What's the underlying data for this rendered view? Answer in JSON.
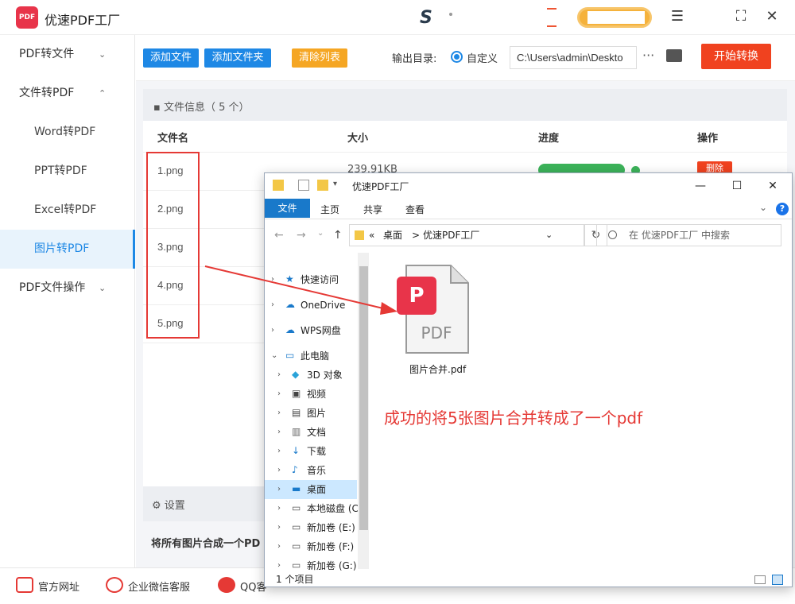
{
  "app": {
    "title": "优速PDF工厂",
    "logo_text": "PDF",
    "window_controls": [
      "menu-icon",
      "fullscreen-icon",
      "close-icon"
    ]
  },
  "sidebar": {
    "items": [
      {
        "label": "PDF转文件",
        "expanded": false
      },
      {
        "label": "文件转PDF",
        "expanded": true
      },
      {
        "label": "Word转PDF"
      },
      {
        "label": "PPT转PDF"
      },
      {
        "label": "Excel转PDF"
      },
      {
        "label": "图片转PDF",
        "active": true
      },
      {
        "label": "PDF文件操作",
        "expanded": false
      }
    ]
  },
  "toolbar": {
    "add_file": "添加文件",
    "add_folder": "添加文件夹",
    "clear_list": "清除列表",
    "output_label": "输出目录:",
    "custom_label": "自定义",
    "output_path": "C:\\Users\\admin\\Deskto",
    "more": "···",
    "start": "开始转换"
  },
  "file_list": {
    "info": "文件信息（ 5 个）",
    "headers": {
      "name": "文件名",
      "size": "大小",
      "progress": "进度",
      "action": "操作"
    },
    "files": [
      "1.png",
      "2.png",
      "3.png",
      "4.png",
      "5.png"
    ],
    "first_size": "239.91KB",
    "first_progress": 1.0,
    "delete_label": "删除"
  },
  "settings": {
    "label": "设置",
    "merge_option": "将所有图片合成一个PD"
  },
  "bottom": {
    "website": "官方网址",
    "wechat": "企业微信客服",
    "qq": "QQ客"
  },
  "explorer": {
    "title": "优速PDF工厂",
    "ribbon": {
      "file": "文件",
      "home": "主页",
      "share": "共享",
      "view": "查看"
    },
    "address": {
      "prefix": "«",
      "desktop": "桌面",
      "sep": ">",
      "folder": "优速PDF工厂"
    },
    "search_placeholder": "在 优速PDF工厂 中搜索",
    "nav": [
      {
        "label": "快速访问",
        "icon": "star-icon"
      },
      {
        "label": "OneDrive",
        "icon": "cloud-icon"
      },
      {
        "label": "WPS网盘",
        "icon": "cloud-icon"
      },
      {
        "label": "此电脑",
        "icon": "computer-icon"
      },
      {
        "label": "3D 对象",
        "icon": "cube-icon"
      },
      {
        "label": "视频",
        "icon": "video-icon"
      },
      {
        "label": "图片",
        "icon": "picture-icon"
      },
      {
        "label": "文档",
        "icon": "document-icon"
      },
      {
        "label": "下载",
        "icon": "download-icon"
      },
      {
        "label": "音乐",
        "icon": "music-icon"
      },
      {
        "label": "桌面",
        "icon": "desktop-icon",
        "selected": true
      },
      {
        "label": "本地磁盘 (C",
        "icon": "drive-icon"
      },
      {
        "label": "新加卷 (E:)",
        "icon": "drive-icon"
      },
      {
        "label": "新加卷 (F:)",
        "icon": "drive-icon"
      },
      {
        "label": "新加卷 (G:)",
        "icon": "drive-icon"
      }
    ],
    "file": {
      "name": "图片合并.pdf",
      "icon_text": "PDF"
    },
    "status": "1 个项目"
  },
  "annotation": "成功的将5张图片合并转成了一个pdf",
  "colors": {
    "brand_red": "#e8344a",
    "accent_blue": "#1e88e5",
    "start_orange": "#f0421f",
    "clear_orange": "#f5a623",
    "progress_green": "#3cb35a",
    "annotation_red": "#e53935"
  }
}
